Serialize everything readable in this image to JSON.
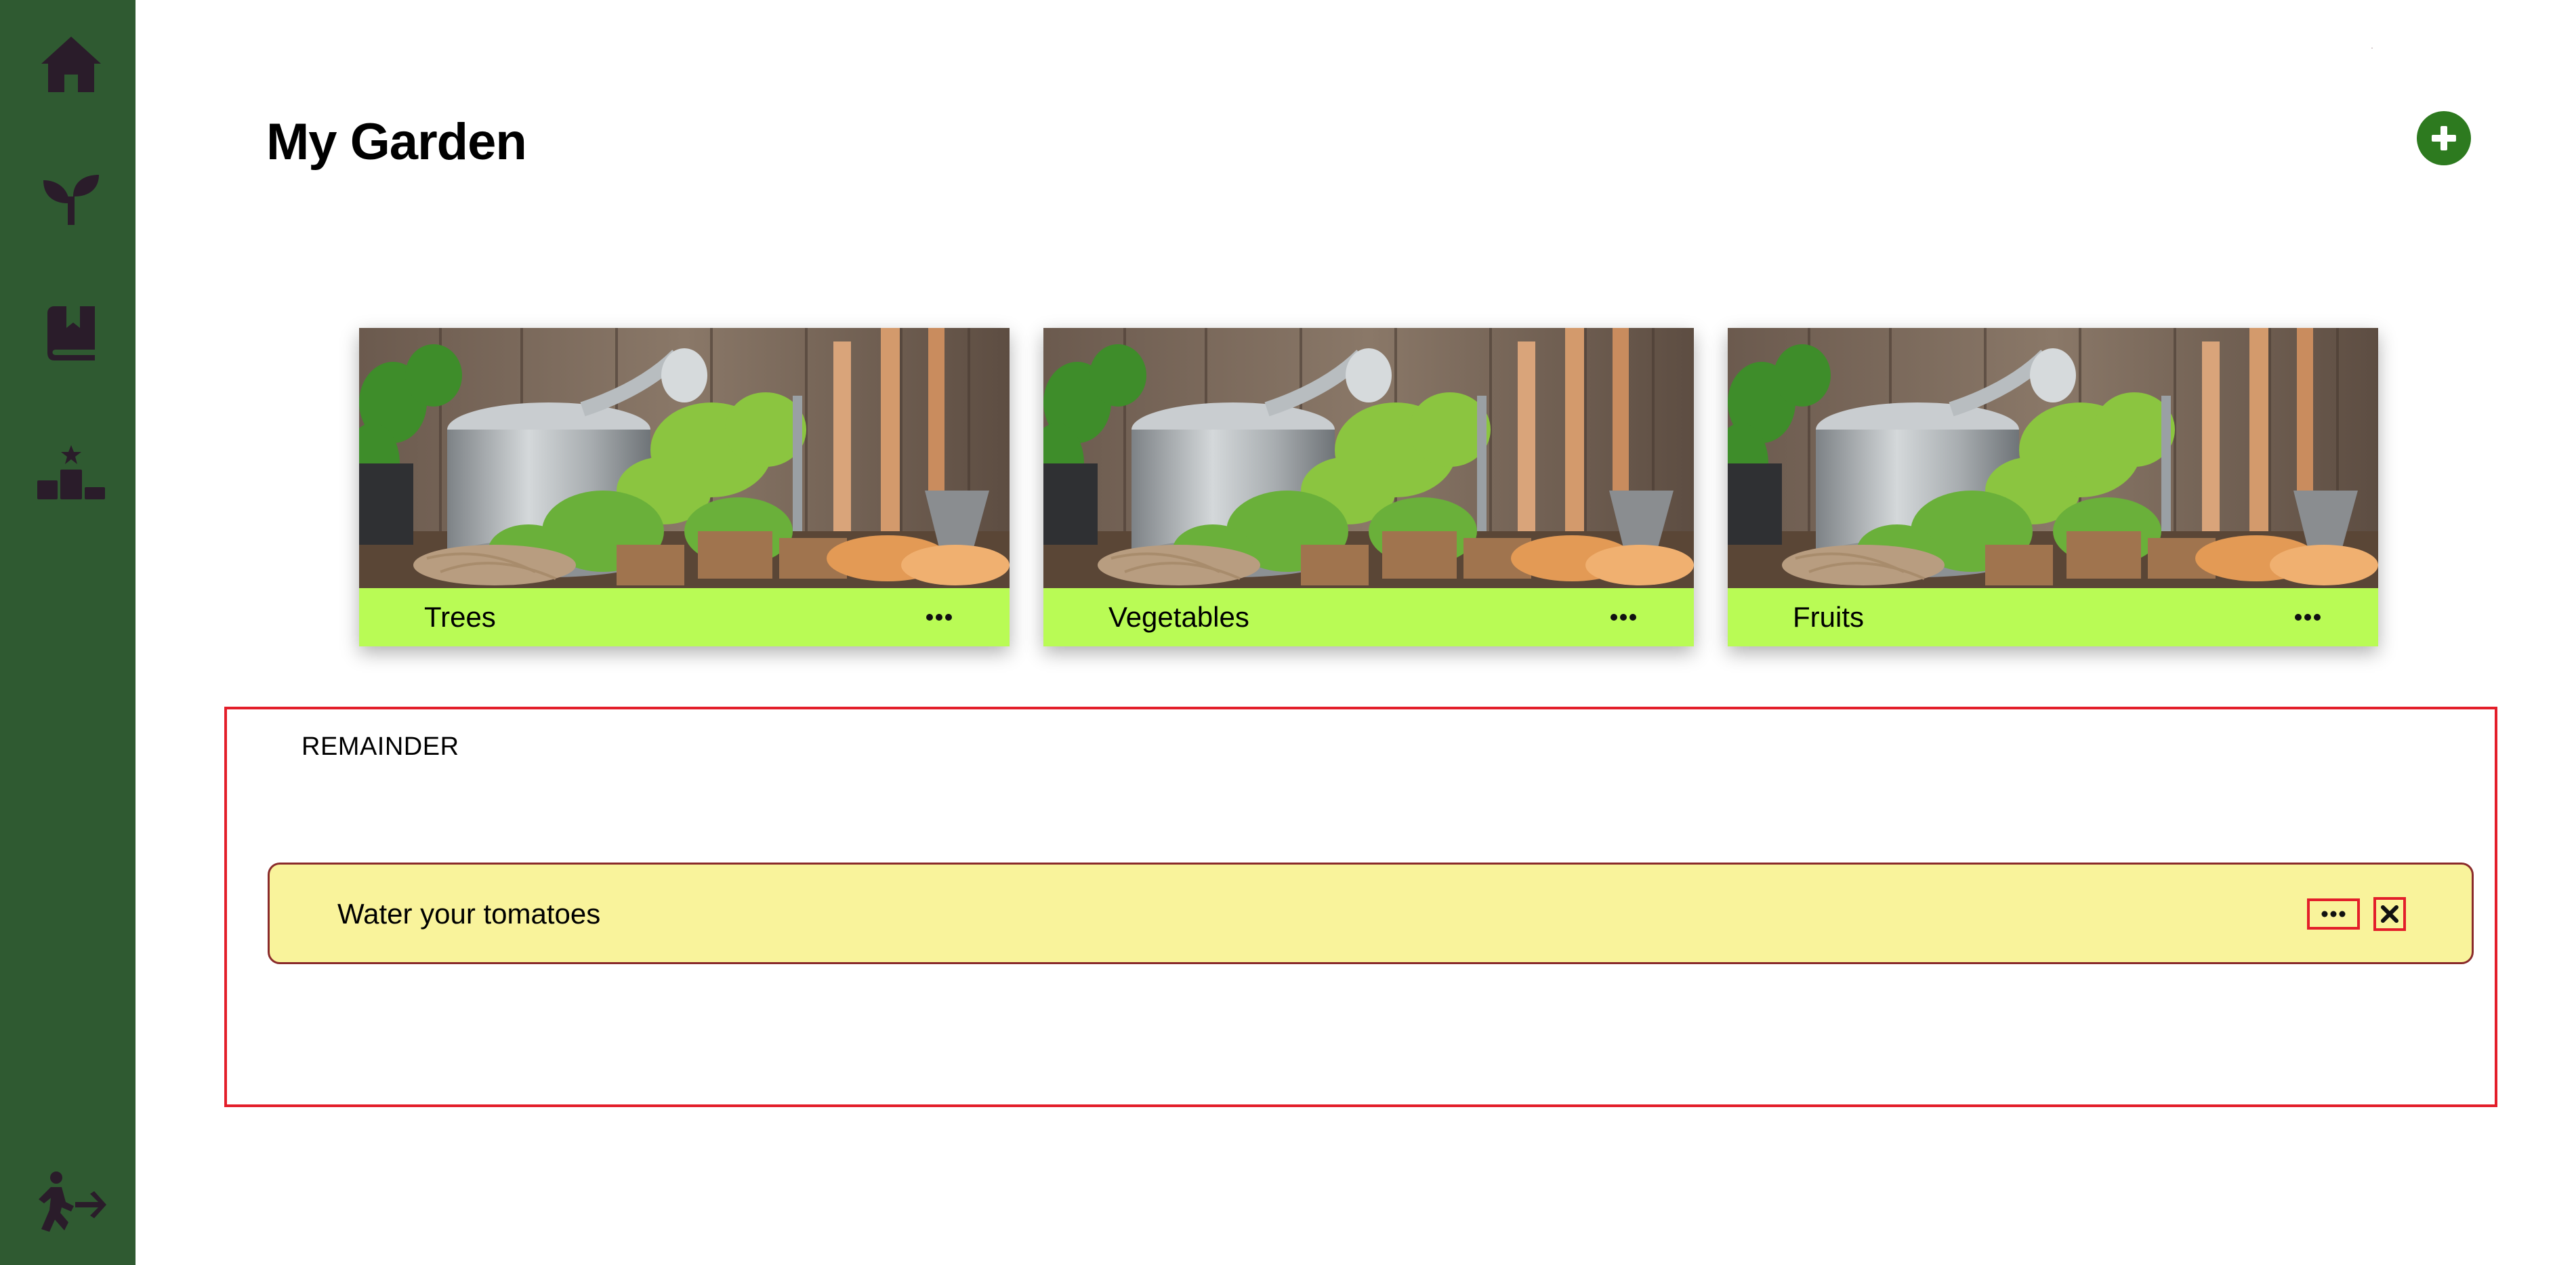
{
  "sidebar": {
    "icons": [
      {
        "name": "home-icon"
      },
      {
        "name": "sprout-icon"
      },
      {
        "name": "book-bookmark-icon"
      },
      {
        "name": "ranking-podium-icon"
      },
      {
        "name": "logout-person-arrow-icon"
      }
    ],
    "background": "#2f5a31",
    "icon_color": "#2a1c2a"
  },
  "header": {
    "title": "My Garden",
    "add_button_icon": "plus-circle-icon",
    "add_button_color": "#2d7a1f"
  },
  "cards": [
    {
      "label": "Trees",
      "menu_icon": "ellipsis-icon"
    },
    {
      "label": "Vegetables",
      "menu_icon": "ellipsis-icon"
    },
    {
      "label": "Fruits",
      "menu_icon": "ellipsis-icon"
    }
  ],
  "card_footer_color": "#b9fb55",
  "reminder": {
    "title": "REMAINDER",
    "items": [
      {
        "text": "Water your tomatoes",
        "menu_icon": "ellipsis-icon",
        "close_icon": "close-icon"
      }
    ],
    "item_background": "#f9f39b",
    "highlight_color": "#e31e2a"
  }
}
